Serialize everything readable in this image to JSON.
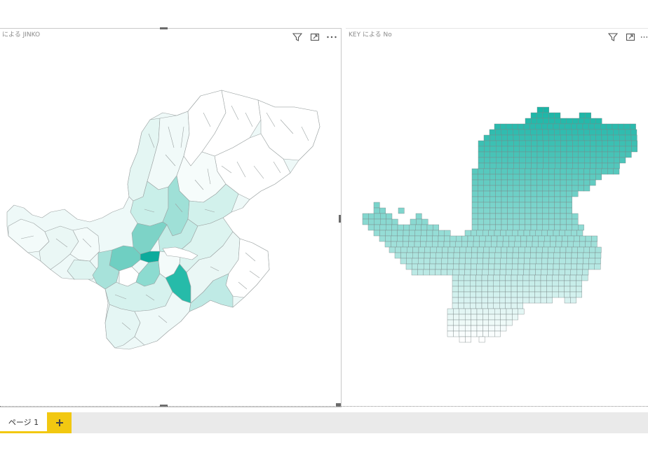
{
  "visuals": {
    "left": {
      "title": "による JINKO"
    },
    "right": {
      "title": "KEY による No"
    }
  },
  "icons": {
    "filter": "filter-icon",
    "focus": "focus-mode-icon",
    "more": "more-options-icon",
    "add": "plus-icon"
  },
  "colors": {
    "accent": "#01b8aa",
    "fill_light": "#eef9f8",
    "fill_mid": "#bfeae5",
    "fill_dark": "#1fb9a9",
    "grid_top": "#1ab5a6",
    "grid_bottom": "#ffffff",
    "tab_accent": "#f2c811"
  },
  "tabs": [
    {
      "label": "ページ 1"
    }
  ]
}
